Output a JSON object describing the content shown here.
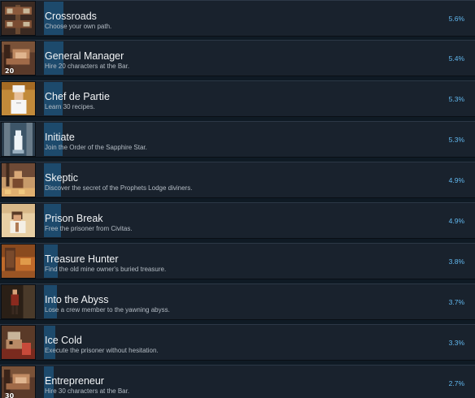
{
  "achievements": [
    {
      "title": "Crossroads",
      "description": "Choose your own path.",
      "percent": "5.6%",
      "fill": 5.6,
      "icon": "crossroads-signpost-icon"
    },
    {
      "title": "General Manager",
      "description": "Hire 20 characters at the Bar.",
      "percent": "5.4%",
      "fill": 5.4,
      "icon": "general-manager-icon",
      "badge": "20"
    },
    {
      "title": "Chef de Partie",
      "description": "Learn 30 recipes.",
      "percent": "5.3%",
      "fill": 5.3,
      "icon": "chef-icon"
    },
    {
      "title": "Initiate",
      "description": "Join the Order of the Sapphire Star.",
      "percent": "5.3%",
      "fill": 5.3,
      "icon": "initiate-icon"
    },
    {
      "title": "Skeptic",
      "description": "Discover the secret of the Prophets Lodge diviners.",
      "percent": "4.9%",
      "fill": 4.9,
      "icon": "skeptic-icon"
    },
    {
      "title": "Prison Break",
      "description": "Free the prisoner from Civitas.",
      "percent": "4.9%",
      "fill": 4.9,
      "icon": "prison-break-icon"
    },
    {
      "title": "Treasure Hunter",
      "description": "Find the old mine owner's buried treasure.",
      "percent": "3.8%",
      "fill": 3.8,
      "icon": "treasure-hunter-icon"
    },
    {
      "title": "Into the Abyss",
      "description": "Lose a crew member to the yawning abyss.",
      "percent": "3.7%",
      "fill": 3.7,
      "icon": "abyss-icon"
    },
    {
      "title": "Ice Cold",
      "description": "Execute the prisoner without hesitation.",
      "percent": "3.3%",
      "fill": 3.3,
      "icon": "ice-cold-icon"
    },
    {
      "title": "Entrepreneur",
      "description": "Hire 30 characters at the Bar.",
      "percent": "2.7%",
      "fill": 2.7,
      "icon": "entrepreneur-icon",
      "badge": "30"
    }
  ],
  "colors": {
    "row_bg": "#19222d",
    "bar": "#1d4a6c",
    "percent_text": "#62b9f0",
    "title_text": "#f2f4f6",
    "description_text": "#b4bcc4"
  }
}
